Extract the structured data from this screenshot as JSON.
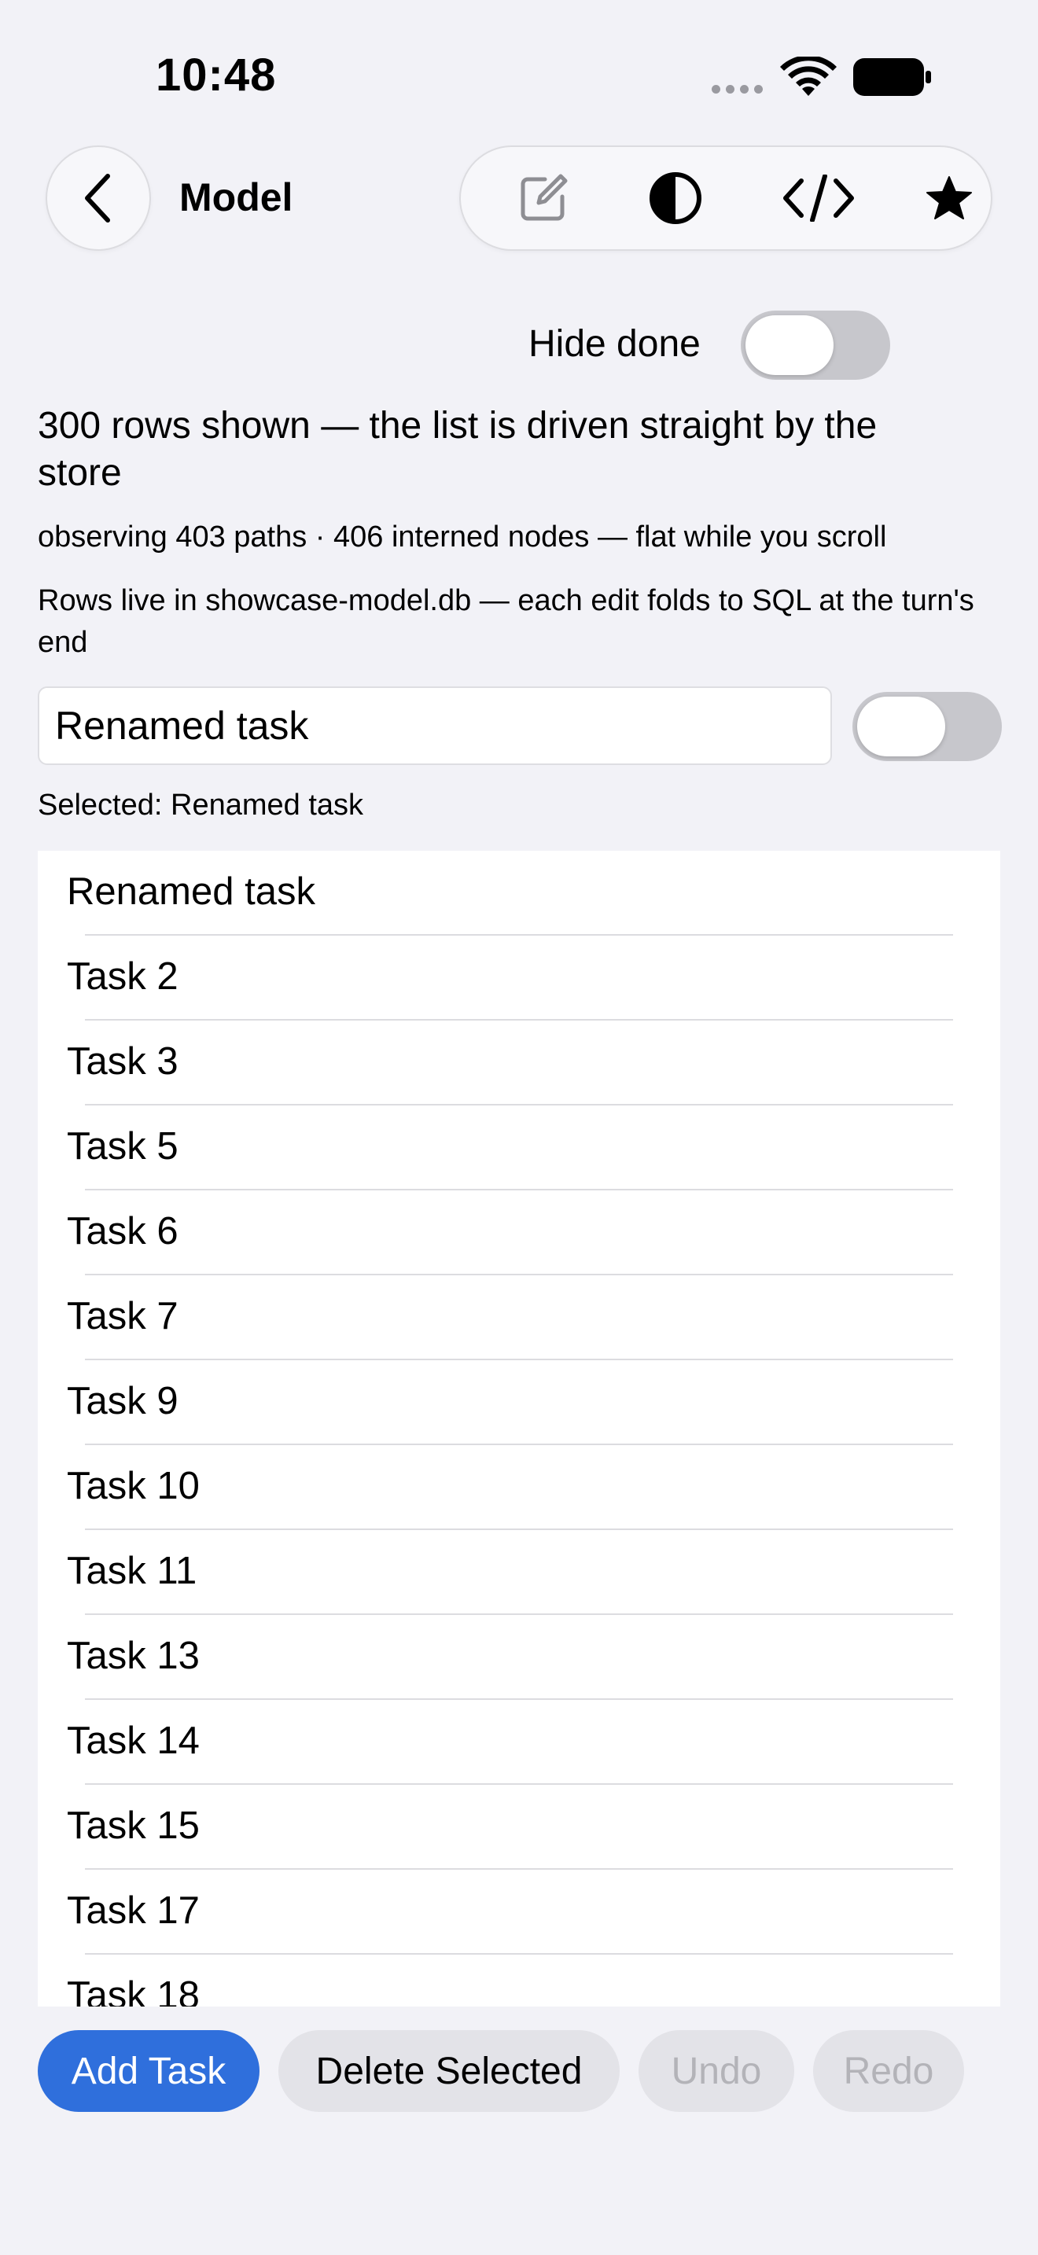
{
  "status_bar": {
    "time": "10:48"
  },
  "nav": {
    "title": "Model"
  },
  "toolbar": {
    "tools": [
      {
        "icon": "edit-icon"
      },
      {
        "icon": "contrast-icon"
      },
      {
        "icon": "code-icon"
      },
      {
        "icon": "star-icon"
      }
    ]
  },
  "hide_done": {
    "label": "Hide done",
    "on": false
  },
  "summary": {
    "rows_shown": "300 rows shown — the list is driven straight by the store",
    "observing": "observing 403 paths · 406 interned nodes — flat while you scroll",
    "rows_live": "Rows live in showcase-model.db — each edit folds to SQL at the turn's end"
  },
  "editor": {
    "value": "Renamed task",
    "toggle_on": false
  },
  "selected_text": "Selected: Renamed task",
  "tasks": [
    "Renamed task",
    "Task 2",
    "Task 3",
    "Task 5",
    "Task 6",
    "Task 7",
    "Task 9",
    "Task 10",
    "Task 11",
    "Task 13",
    "Task 14",
    "Task 15",
    "Task 17",
    "Task 18"
  ],
  "buttons": {
    "add": "Add Task",
    "delete": "Delete Selected",
    "undo": "Undo",
    "redo": "Redo"
  },
  "colors": {
    "accent": "#2f6fdc",
    "background": "#f2f2f7",
    "toggle_off": "#c7c7cc"
  }
}
